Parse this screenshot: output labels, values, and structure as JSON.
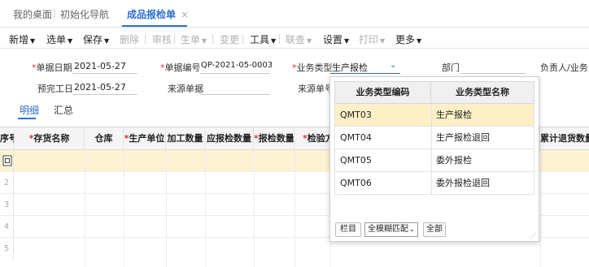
{
  "tabs": [
    {
      "label": "我的桌面"
    },
    {
      "label": "初始化导航"
    },
    {
      "label": "成品报检单",
      "close": "×"
    }
  ],
  "toolbar": {
    "new": "新增",
    "select_bill": "选单",
    "save": "保存",
    "delete": "删除",
    "review": "审核",
    "generate": "生单",
    "change": "变更",
    "tools": "工具",
    "query": "联查",
    "settings": "设置",
    "print": "打印",
    "more": "更多"
  },
  "form": {
    "bill_date_label": "单据日期",
    "bill_date": "2021-05-27",
    "bill_no_label": "单据编号",
    "bill_no": "QP-2021-05-0003",
    "biz_type_label": "业务类型",
    "biz_type": "生产报检",
    "dept_label": "部门",
    "owner_label": "负责人/业务员",
    "finish_date_label": "预完工日",
    "finish_date": "2021-05-27",
    "source_bill_label": "来源单据",
    "source_no_label": "来源单号"
  },
  "detail_tabs": {
    "detail": "明细",
    "summary": "汇总"
  },
  "grid": {
    "headers": [
      "序号",
      "存货名称",
      "仓库",
      "生产单位",
      "加工数量",
      "应报检数量",
      "报检数量",
      "检验方",
      "累计退货数量"
    ],
    "required": [
      "存货名称",
      "生产单位",
      "报检数量",
      "检验方"
    ],
    "rows": [
      "",
      "2",
      "3",
      "4",
      "5"
    ]
  },
  "dropdown": {
    "col_code": "业务类型编码",
    "col_name": "业务类型名称",
    "items": [
      {
        "code": "QMT03",
        "name": "生产报检"
      },
      {
        "code": "QMT04",
        "name": "生产报检退回"
      },
      {
        "code": "QMT05",
        "name": "委外报检"
      },
      {
        "code": "QMT06",
        "name": "委外报检退回"
      }
    ],
    "btn_columns": "栏目",
    "match_mode": "全模糊匹配",
    "btn_all": "全部"
  },
  "colors": {
    "accent": "#2f6fd1",
    "required": "#e03131",
    "highlight": "#fdf0c6"
  }
}
